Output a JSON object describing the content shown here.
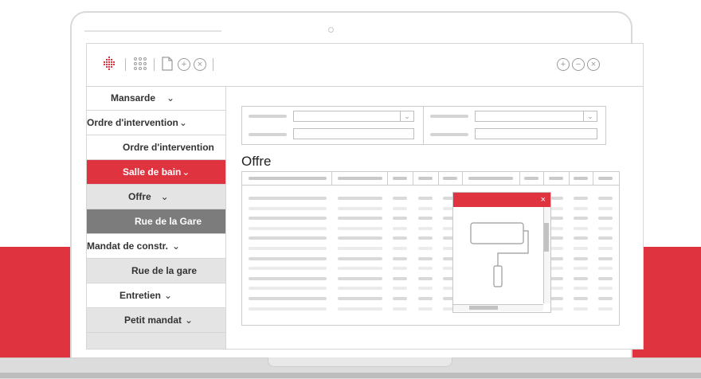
{
  "colors": {
    "accent": "#e03340",
    "active_subitem": "#7c7c7c",
    "subitem_bg": "#e4e4e4"
  },
  "toolbar": {
    "icons": [
      "diamond-logo-icon",
      "grid-icon",
      "document-icon",
      "plus-circle-icon",
      "close-circle-icon"
    ],
    "right_icons": [
      "zoom-in-icon",
      "zoom-out-icon",
      "close-icon"
    ]
  },
  "sidebar": {
    "items": [
      {
        "label": "Mansarde",
        "chevron": "⌄"
      },
      {
        "label": "Ordre d'intervention",
        "chevron": "⌄"
      },
      {
        "label": "Ordre d'intervention",
        "chevron": ""
      },
      {
        "label": "Salle de bain",
        "chevron": "⌄"
      },
      {
        "label": "Offre",
        "chevron": "⌄"
      },
      {
        "label": "Rue de la Gare",
        "chevron": ""
      },
      {
        "label": "Mandat de constr.",
        "chevron": "⌄"
      },
      {
        "label": "Rue de la gare",
        "chevron": ""
      },
      {
        "label": "Entretien",
        "chevron": "⌄"
      },
      {
        "label": "Petit mandat",
        "chevron": "⌄"
      }
    ]
  },
  "main": {
    "title": "Offre",
    "popup": {
      "close_label": "×"
    }
  }
}
